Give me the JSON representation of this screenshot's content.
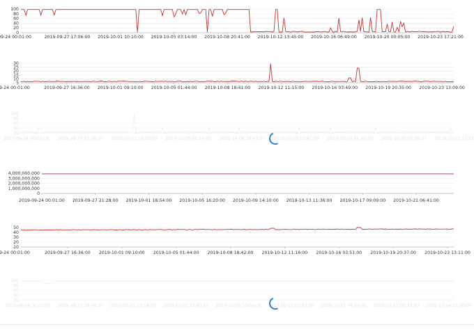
{
  "panels": [
    {
      "id": "p1",
      "loading": false,
      "y_ticks": [
        "100",
        "80",
        "60",
        "40",
        "20",
        "0"
      ],
      "x_ticks": [
        "-09-24 00:01:00",
        "2019-09-27 17:06:00",
        "2019-10-01 10:10:00",
        "2019-10-05 03:14:00",
        "2019-10-08 20:41:00",
        "2019-10-12 13:45:00",
        "2019-10-16 06:49:00",
        "2019-10-20 00:05:00",
        "2019-10-23 17:21:00"
      ]
    },
    {
      "id": "p2",
      "loading": false,
      "y_ticks": [
        "30",
        "25",
        "20",
        "15",
        "10",
        "5"
      ],
      "x_ticks": [
        "19-24 00:01:00",
        "2019-09-27 16:36:00",
        "2019-10-01 09:10:00",
        "2019-10-05 01:44:00",
        "2019-10-08 18:41:00",
        "2019-10-12 11:15:00",
        "2019-10-16 03:49:00",
        "2019-10-19 20:35:00",
        "2019-10-23 13:09:00"
      ]
    },
    {
      "id": "p3",
      "loading": true,
      "y_ticks": [
        "100",
        "80",
        "60",
        "40",
        "20"
      ],
      "x_ticks": [
        "2019-09-24 00:01:00",
        "2019-09-27 17:06:00",
        "2019-10-01 10:10:00",
        "2019-10-05 03:14:00",
        "2019-10-08 20:41:00",
        "2019-10-12 13:45:00",
        "2019-10-16 06:49:00",
        "2019-10-20 00:05:00",
        "2019-10-23 17:21:00"
      ]
    },
    {
      "id": "p4",
      "loading": false,
      "y_ticks": [
        "4,000,000,000",
        "3,000,000,000",
        "2,000,000,000",
        "1,000,000,000",
        "0"
      ],
      "x_ticks": [
        "2019-09-24 00:01:00",
        "2019-09-27 21:28:00",
        "2019-10-01 18:54:00",
        "2019-10-05 16:20:00",
        "2019-10-09 14:10:00",
        "2019-10-13 11:36:00",
        "2019-10-17 09:09:00",
        "2019-10-21 06:41:00"
      ]
    },
    {
      "id": "p5",
      "loading": false,
      "y_ticks": [
        "50",
        "40",
        "30",
        "20",
        "10"
      ],
      "x_ticks": [
        "19-24 00:01:00",
        "2019-09-27 16:36:00",
        "2019-10-01 09:10:00",
        "2019-10-05 01:44:00",
        "2019-10-08 18:42:00",
        "2019-10-12 11:16:00",
        "2019-10-16 03:51:00",
        "2019-10-19 20:37:00",
        "2019-10-23 13:11:00"
      ]
    },
    {
      "id": "p6",
      "loading": true,
      "y_ticks": [
        "100",
        "80",
        "60",
        "40",
        "20"
      ],
      "x_ticks": [
        "2019-09-24 00:01:00",
        "2019-09-27 20:46:00",
        "2019-10-01 17:14:00",
        "2019-10-05 13:43:00",
        "2019-10-09 10:09:00",
        "2019-10-13 07:37:00",
        "2019-10-17 04:04:00",
        "2019-10-21 00:32:00",
        "2019-10-24 21:00:00"
      ]
    }
  ],
  "chart_data": [
    {
      "type": "line",
      "y_range": [
        0,
        100
      ],
      "grid": true,
      "x": [
        "2019-09-24 00:01:00",
        "2019-09-27 17:06:00",
        "2019-10-01 10:10:00",
        "2019-10-05 03:14:00",
        "2019-10-08 20:41:00",
        "2019-10-12 13:45:00",
        "2019-10-16 06:49:00",
        "2019-10-20 00:05:00",
        "2019-10-23 17:21:00"
      ],
      "values": [
        100,
        100,
        100,
        100,
        100,
        5,
        10,
        8,
        8
      ],
      "note_values": "approximate; long plateau at 100 then drops near 0 with spikes up to 100"
    },
    {
      "type": "line",
      "y_range": [
        0,
        30
      ],
      "grid": true,
      "x": [
        "2019-09-24 00:01:00",
        "2019-09-27 16:36:00",
        "2019-10-01 09:10:00",
        "2019-10-05 01:44:00",
        "2019-10-08 18:41:00",
        "2019-10-12 11:15:00",
        "2019-10-16 03:49:00",
        "2019-10-19 20:35:00",
        "2019-10-23 13:09:00"
      ],
      "values": [
        2,
        2,
        2,
        2,
        2,
        30,
        2,
        2,
        2
      ]
    },
    {
      "type": "line",
      "y_range": [
        0,
        100
      ],
      "grid": true,
      "x": [
        "2019-09-24 00:01:00",
        "2019-09-27 17:06:00",
        "2019-10-01 10:10:00",
        "2019-10-05 03:14:00",
        "2019-10-08 20:41:00",
        "2019-10-12 13:45:00",
        "2019-10-16 06:49:00",
        "2019-10-20 00:05:00",
        "2019-10-23 17:21:00"
      ],
      "values": [
        2,
        10,
        100,
        5,
        5,
        5,
        5,
        5,
        5
      ]
    },
    {
      "type": "line",
      "y_range": [
        0,
        4000000000
      ],
      "grid": true,
      "x": [
        "2019-09-24 00:01:00",
        "2019-09-27 21:28:00",
        "2019-10-01 18:54:00",
        "2019-10-05 16:20:00",
        "2019-10-09 14:10:00",
        "2019-10-13 11:36:00",
        "2019-10-17 09:09:00",
        "2019-10-21 06:41:00"
      ],
      "values": [
        4000000000,
        4000000000,
        4000000000,
        4000000000,
        4000000000,
        4000000000,
        4000000000,
        4000000000
      ]
    },
    {
      "type": "line",
      "y_range": [
        0,
        50
      ],
      "grid": true,
      "x": [
        "2019-09-24 00:01:00",
        "2019-09-27 16:36:00",
        "2019-10-01 09:10:00",
        "2019-10-05 01:44:00",
        "2019-10-08 18:42:00",
        "2019-10-12 11:16:00",
        "2019-10-16 03:51:00",
        "2019-10-19 20:37:00",
        "2019-10-23 13:11:00"
      ],
      "values": [
        45,
        45,
        45,
        45,
        45,
        47,
        47,
        48,
        49
      ]
    },
    {
      "type": "line",
      "y_range": [
        0,
        100
      ],
      "grid": true,
      "x": [
        "2019-09-24 00:01:00",
        "2019-09-27 20:46:00",
        "2019-10-01 17:14:00",
        "2019-10-05 13:43:00",
        "2019-10-09 10:09:00",
        "2019-10-13 07:37:00",
        "2019-10-17 04:04:00",
        "2019-10-21 00:32:00",
        "2019-10-24 21:00:00"
      ],
      "values": [
        95,
        95,
        95,
        95,
        95,
        95,
        95,
        95,
        95
      ]
    }
  ]
}
